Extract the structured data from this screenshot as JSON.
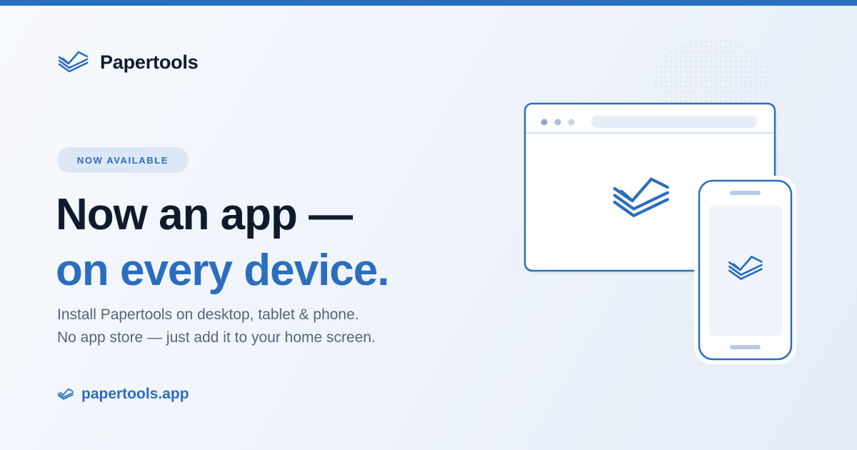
{
  "brand": {
    "name": "Papertools",
    "logo_icon": "paper-stack-check-icon"
  },
  "badge": {
    "label": "NOW AVAILABLE"
  },
  "headline": {
    "line1": "Now an app —",
    "line2": "on every device."
  },
  "subtitle": {
    "line1": "Install Papertools on desktop, tablet & phone.",
    "line2": "No app store — just add it to your home screen."
  },
  "footer": {
    "url": "papertools.app",
    "url_icon": "paper-stack-check-icon"
  },
  "illustration": {
    "desktop_icon": "browser-window-icon",
    "phone_icon": "phone-icon"
  },
  "colors": {
    "accent": "#2a6ebf",
    "heading": "#0f1b2d",
    "body_text": "#55657a",
    "badge_bg": "#dde8f6",
    "background": "#eef3fa"
  }
}
